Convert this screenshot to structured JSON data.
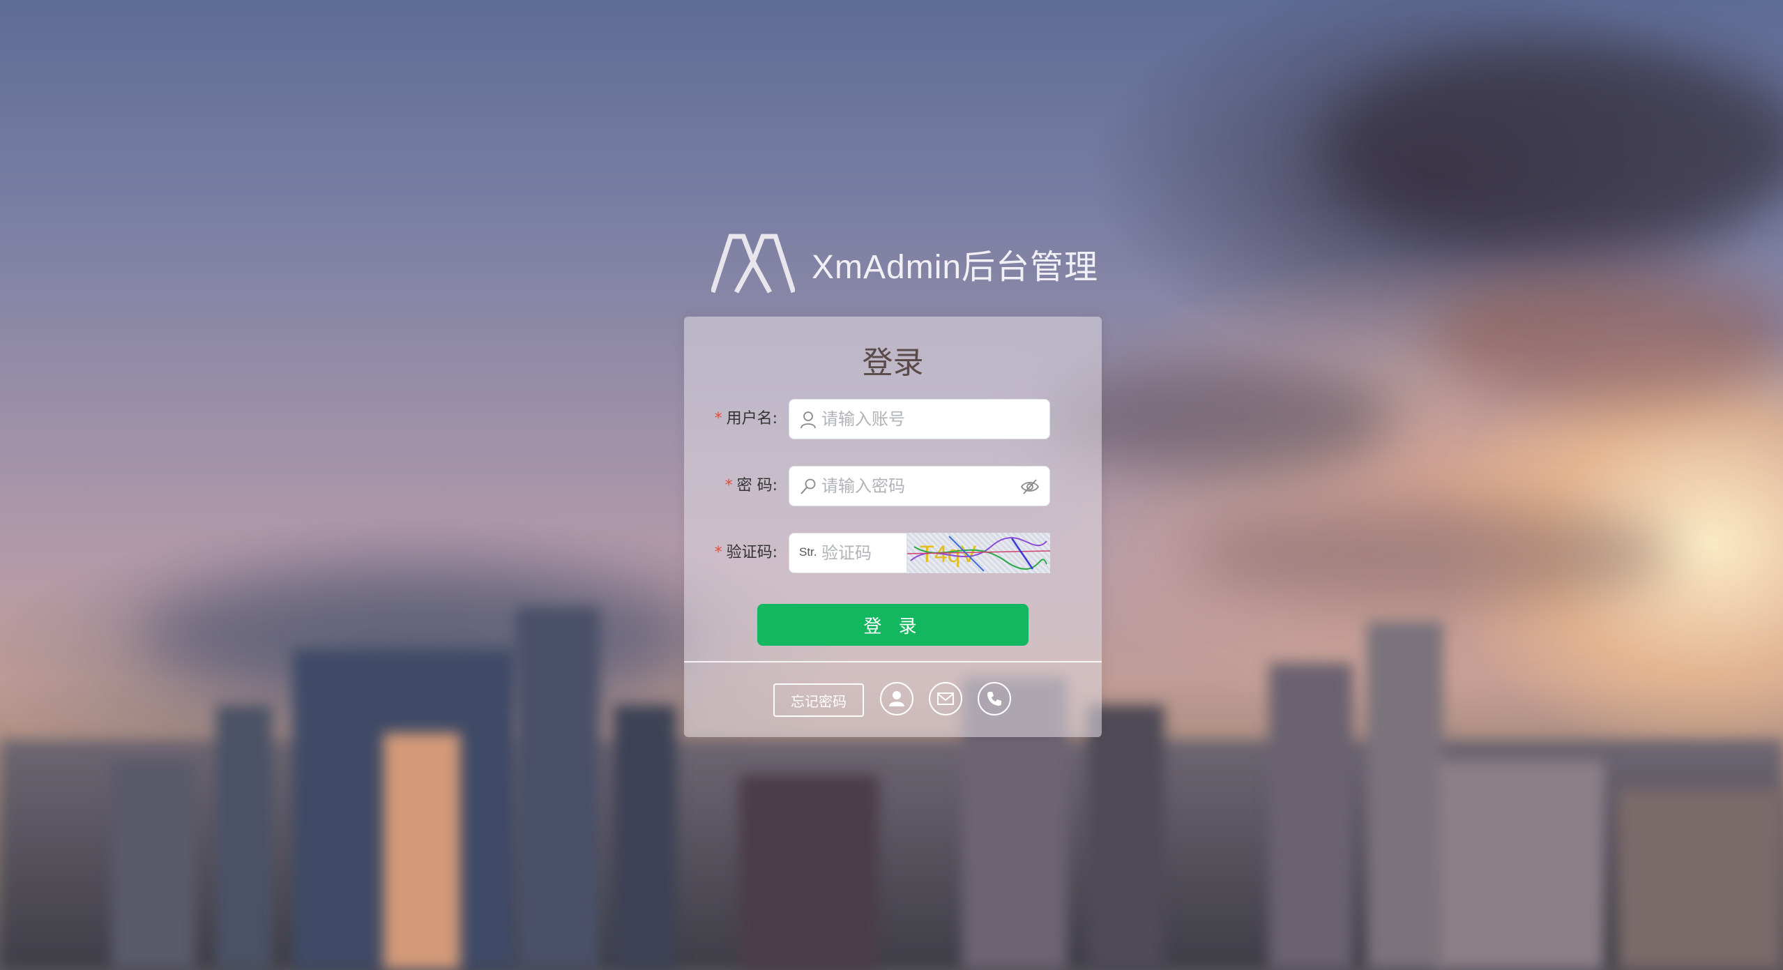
{
  "header": {
    "title": "XmAdmin后台管理",
    "logo_icon": "xm-logo-icon"
  },
  "login": {
    "title": "登录",
    "username": {
      "label": "用户名:",
      "placeholder": "请输入账号",
      "icon": "user-icon",
      "value": ""
    },
    "password": {
      "label": "密 码:",
      "placeholder": "请输入密码",
      "icon": "key-icon",
      "suffix_icon": "eye-off-icon",
      "value": ""
    },
    "captcha": {
      "label": "验证码:",
      "prefix": "Str.",
      "placeholder": "验证码",
      "value": "",
      "image_text": "T4qV"
    },
    "submit_label": "登 录",
    "required_mark": "*"
  },
  "footer": {
    "forgot_label": "忘记密码",
    "icons": [
      "user-circle-icon",
      "mail-icon",
      "phone-icon"
    ]
  },
  "colors": {
    "primary": "#13b75f",
    "required": "#e74c3c",
    "card_bg": "rgba(225,220,228,0.55)"
  }
}
